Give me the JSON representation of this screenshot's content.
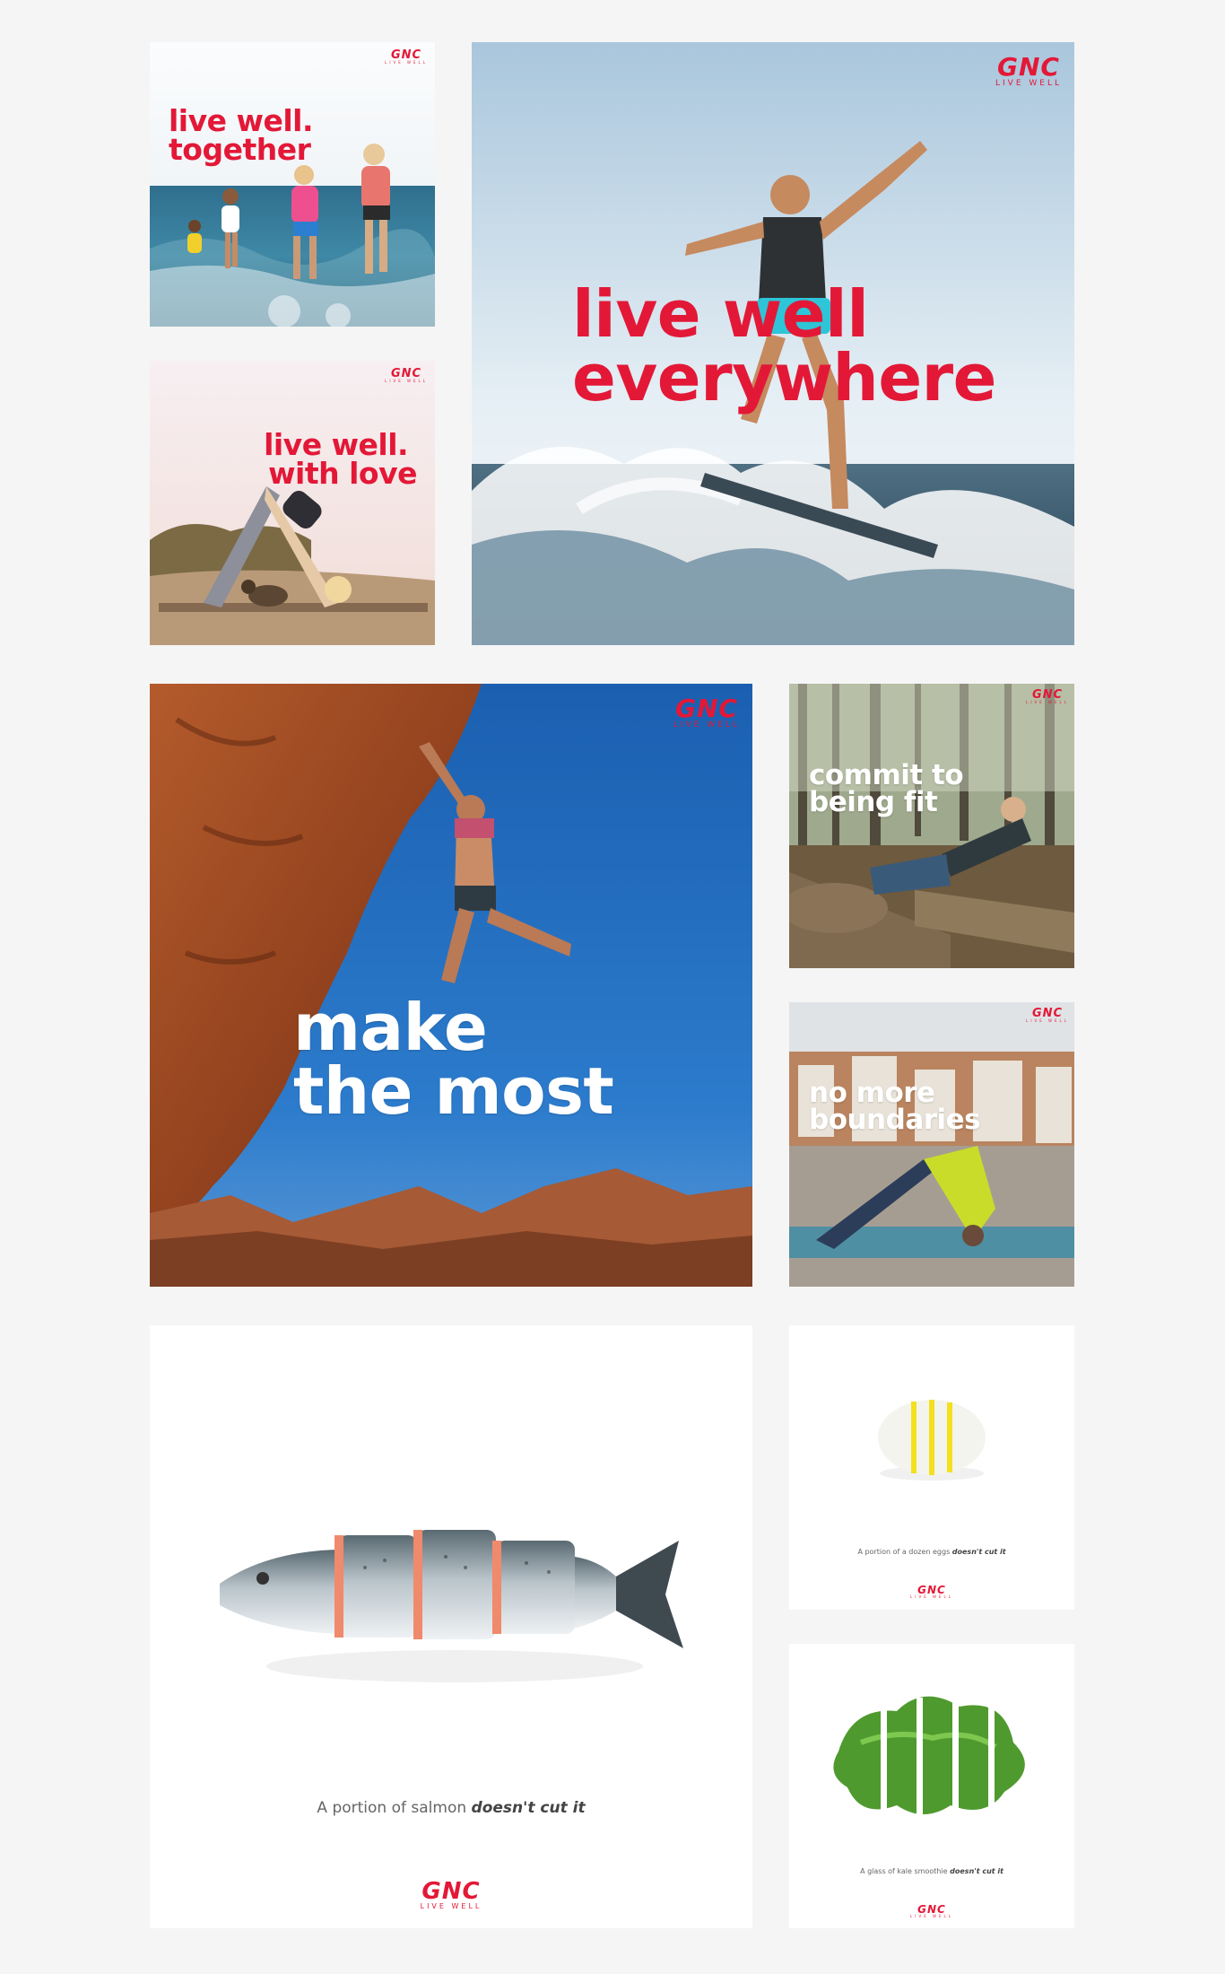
{
  "brand": {
    "name": "GNC",
    "tagline": "LIVE WELL",
    "red": "#e31837"
  },
  "tiles": {
    "together": {
      "line1": "live well.",
      "line2": "together"
    },
    "love": {
      "line1": "live well.",
      "line2": "with love"
    },
    "everywhere": {
      "line1": "live well",
      "line2": "everywhere"
    },
    "most": {
      "line1": "make",
      "line2": "the most"
    },
    "commit": {
      "line1": "commit to",
      "line2": "being fit"
    },
    "boundaries": {
      "line1": "no more",
      "line2": "boundaries"
    },
    "salmon": {
      "caption_plain": "A portion of salmon",
      "caption_emph": "doesn't cut it"
    },
    "eggs": {
      "caption_plain": "A portion of a dozen eggs",
      "caption_emph": "doesn't cut it"
    },
    "kale": {
      "caption_plain": "A glass of kale smoothie",
      "caption_emph": "doesn't cut it"
    }
  }
}
